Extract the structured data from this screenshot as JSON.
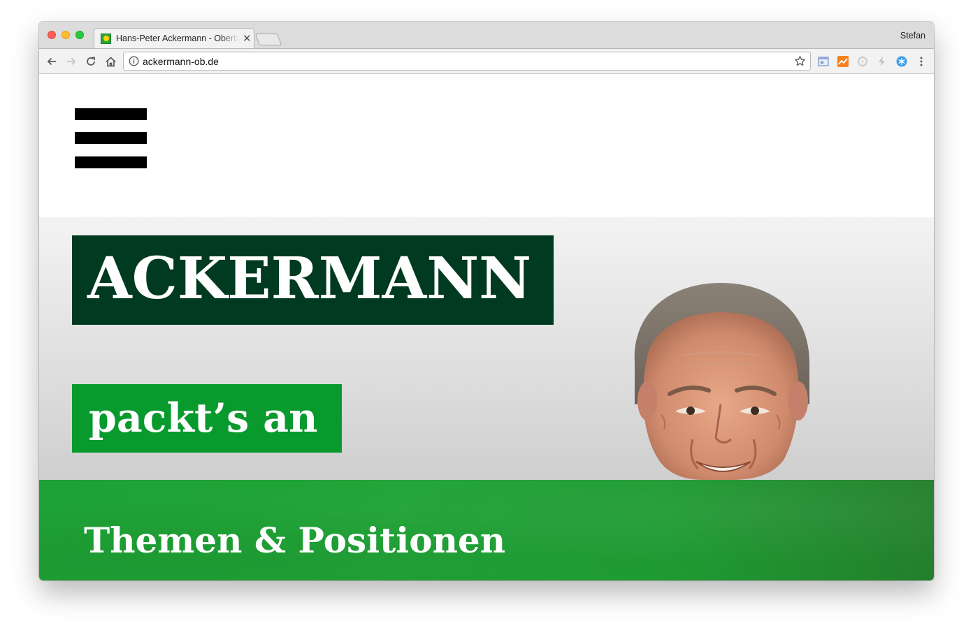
{
  "browser": {
    "tab": {
      "title": "Hans-Peter Ackermann - Oberbürgermeister",
      "close_glyph": "✕",
      "favicon": "sunflower-favicon"
    },
    "profile_name": "Stefan",
    "url": "ackermann-ob.de",
    "nav": {
      "back_icon": "back-arrow-icon",
      "forward_icon": "forward-arrow-icon",
      "reload_icon": "reload-icon",
      "home_icon": "home-icon"
    },
    "extensions": [
      "window-extension-icon",
      "analytics-extension-icon",
      "spiral-extension-icon",
      "lightning-extension-icon",
      "snowflake-extension-icon",
      "menu-dots-icon"
    ]
  },
  "page": {
    "menu_icon": "hamburger-menu-icon",
    "hero": {
      "name": "ACKERMANN",
      "slogan": "packt’s an"
    },
    "band": {
      "link": "Themen & Positionen"
    }
  },
  "colors": {
    "name_box": "#003a20",
    "slogan_box": "#089a2d",
    "band": "#21a437",
    "text_on_color": "#ffffff"
  }
}
